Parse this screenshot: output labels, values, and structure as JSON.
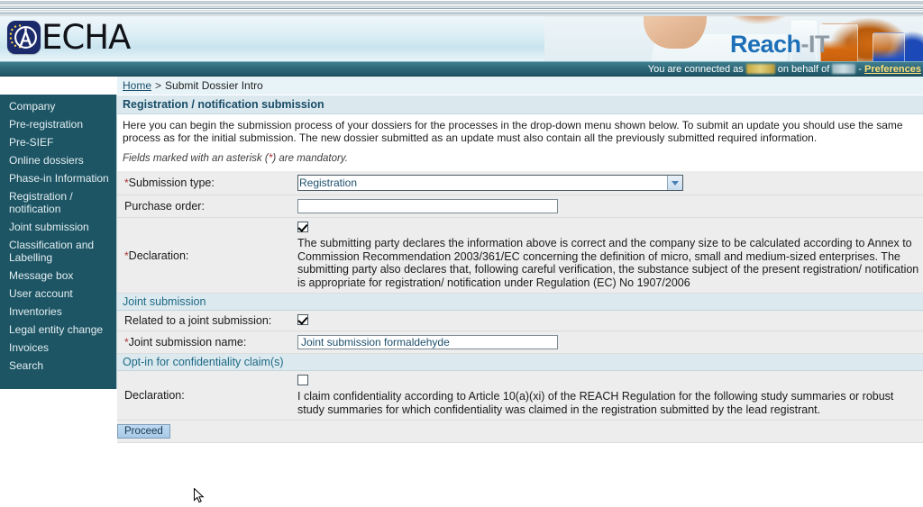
{
  "app": {
    "brand_name": "ECHA",
    "product_name_part1": "Reach",
    "product_name_part2": "-IT",
    "accent_teal": "#1d5565",
    "accent_title": "#184c66",
    "section_header_color": "#1d6a85",
    "logo_navy": "#1b2a6b"
  },
  "connection_bar": {
    "prefix": "You are connected as",
    "middle": "on behalf of",
    "separator": "-",
    "preferences_label": "Preferences",
    "username": "",
    "company": ""
  },
  "breadcrumb": {
    "home_label": "Home",
    "separator": ">",
    "current_label": "Submit Dossier Intro"
  },
  "sidebar": {
    "items": [
      {
        "label": "Company"
      },
      {
        "label": "Pre-registration"
      },
      {
        "label": "Pre-SIEF"
      },
      {
        "label": "Online dossiers"
      },
      {
        "label": "Phase-in Information"
      },
      {
        "label": "Registration / notification"
      },
      {
        "label": "Joint submission"
      },
      {
        "label": "Classification and Labelling"
      },
      {
        "label": "Message box"
      },
      {
        "label": "User account"
      },
      {
        "label": "Inventories"
      },
      {
        "label": "Legal entity change"
      },
      {
        "label": "Invoices"
      },
      {
        "label": "Search"
      }
    ]
  },
  "main": {
    "panel_title": "Registration / notification submission",
    "intro_paragraph": "Here you can begin the submission process of your dossiers for the processes in the drop-down menu shown below. To submit an update you should use the same process as for the initial submission. The new dossier submitted as an update must also contain all the previously submitted required information.",
    "mandatory_note_before": "Fields marked with an asterisk (",
    "mandatory_asterisk": "*",
    "mandatory_note_after": ") are mandatory.",
    "fields": {
      "submission_type_label": "Submission type:",
      "submission_type_value": "Registration",
      "submission_type_options": [
        "Registration"
      ],
      "purchase_order_label": "Purchase order:",
      "purchase_order_value": "",
      "purchase_order_placeholder": "",
      "declaration_label": "Declaration:",
      "declaration_checked": true,
      "declaration_text": "The submitting party declares the information above is correct and the company size to be calculated according to Annex to Commission Recommendation 2003/361/EC concerning the definition of micro, small and medium-sized enterprises. The submitting party also declares that, following careful verification, the substance subject of the present registration/ notification is appropriate for registration/ notification under Regulation (EC) No 1907/2006"
    },
    "joint_submission": {
      "section_title": "Joint submission",
      "related_label": "Related to a joint submission:",
      "related_checked": true,
      "name_label": "Joint submission name:",
      "name_value": "Joint submission formaldehyde",
      "name_placeholder": ""
    },
    "optin": {
      "section_title": "Opt-in for confidentiality claim(s)",
      "declaration_label": "Declaration:",
      "declaration_checked": false,
      "declaration_text": "I claim confidentiality according to Article 10(a)(xi) of the REACH Regulation for the following study summaries or robust study summaries for which confidentiality was claimed in the registration submitted by the lead registrant."
    },
    "proceed_label": "Proceed"
  }
}
